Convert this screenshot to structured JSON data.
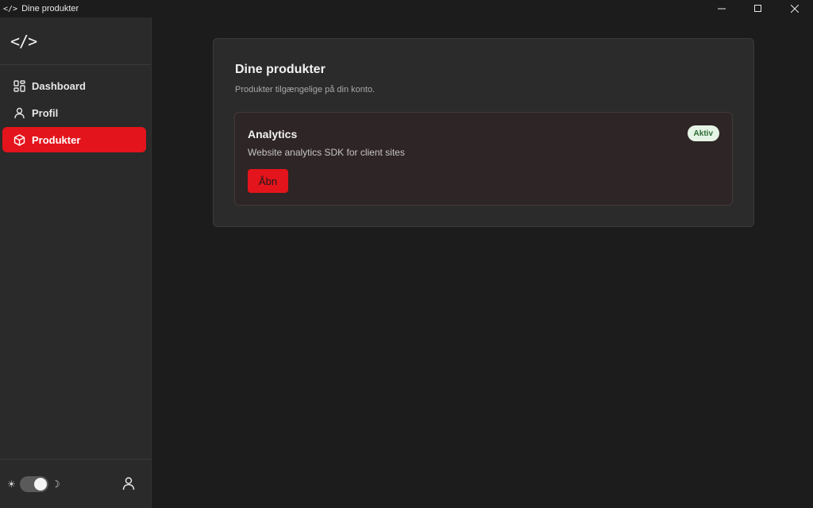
{
  "window": {
    "icon_text": "</>",
    "title": "Dine produkter",
    "controls": [
      "minimize",
      "maximize",
      "close"
    ]
  },
  "sidebar": {
    "logo": "</>",
    "items": [
      {
        "label": "Dashboard",
        "icon": "dashboard-icon",
        "active": false
      },
      {
        "label": "Profil",
        "icon": "user-icon",
        "active": false
      },
      {
        "label": "Produkter",
        "icon": "box-icon",
        "active": true
      }
    ],
    "footer": {
      "sun_glyph": "☀",
      "moon_glyph": "☽",
      "theme_toggle": "dark"
    }
  },
  "main": {
    "title": "Dine produkter",
    "subtitle": "Produkter tilgængelige på din konto.",
    "products": [
      {
        "name": "Analytics",
        "description": "Website analytics SDK for client sites",
        "status": "Aktiv",
        "action_label": "Åbn"
      }
    ]
  },
  "colors": {
    "accent": "#e3141b",
    "background": "#1c1c1c",
    "sidebar": "#2a2a2a",
    "panel": "#2b2b2b",
    "badge_bg": "#e6f4e6",
    "badge_text": "#2b6b32"
  }
}
